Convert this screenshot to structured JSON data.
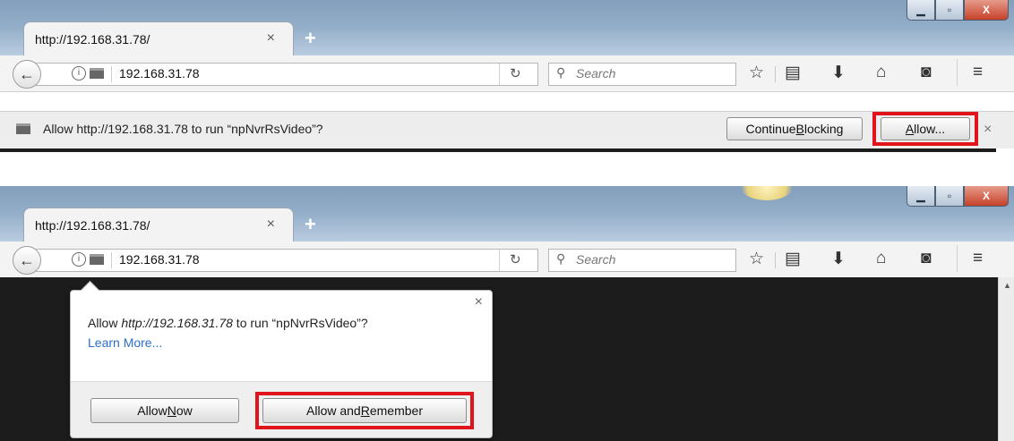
{
  "colors": {
    "highlight": "#e0141b",
    "link": "#2a6fc9",
    "page_bg": "#1c1c1c"
  },
  "icons": [
    "back-arrow-icon",
    "info-icon",
    "plugin-icon",
    "reload-icon",
    "search-icon",
    "bookmark-star-icon",
    "reading-list-icon",
    "download-icon",
    "home-icon",
    "pocket-icon",
    "menu-icon"
  ],
  "top": {
    "tab_title": "http://192.168.31.78/",
    "tab_close": "×",
    "new_tab": "+",
    "url": "192.168.31.78",
    "search_placeholder": "Search",
    "notification": {
      "text": "Allow http://192.168.31.78 to run “npNvrRsVideo”?",
      "continue_pre": "Continue ",
      "continue_key": "B",
      "continue_post": "locking",
      "allow_key": "A",
      "allow_post": "llow...",
      "close": "×"
    }
  },
  "bottom": {
    "tab_title": "http://192.168.31.78/",
    "tab_close": "×",
    "new_tab": "+",
    "url": "192.168.31.78",
    "search_placeholder": "Search",
    "popup": {
      "text_pre": "Allow ",
      "origin": "http://192.168.31.78",
      "text_post": " to run “npNvrRsVideo”?",
      "learn_more": "Learn More...",
      "close": "×",
      "allow_now_pre": "Allow ",
      "allow_now_key": "N",
      "allow_now_post": "ow",
      "remember_pre": "Allow and ",
      "remember_key": "R",
      "remember_post": "emember"
    }
  }
}
